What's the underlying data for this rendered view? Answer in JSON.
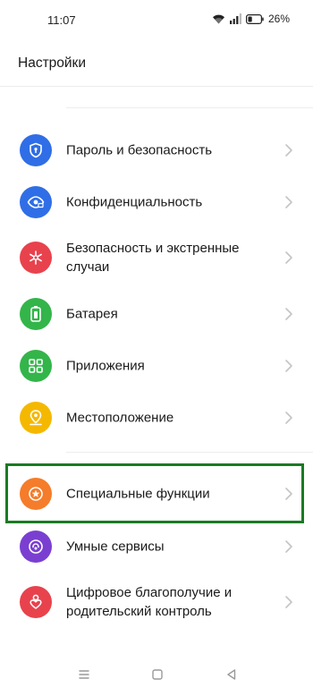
{
  "status_bar": {
    "time": "11:07",
    "battery": "26%"
  },
  "header": {
    "title": "Настройки"
  },
  "items": [
    {
      "label": "Пароль и безопасность",
      "icon": "shield-lock-icon",
      "color": "#2f6ee6"
    },
    {
      "label": "Конфиденциальность",
      "icon": "eye-lock-icon",
      "color": "#2f6ee6"
    },
    {
      "label": "Безопасность и экстренные случаи",
      "icon": "emergency-icon",
      "color": "#e8424d"
    },
    {
      "label": "Батарея",
      "icon": "battery-icon",
      "color": "#33b54a"
    },
    {
      "label": "Приложения",
      "icon": "apps-grid-icon",
      "color": "#33b54a"
    },
    {
      "label": "Местоположение",
      "icon": "location-pin-icon",
      "color": "#f5b800"
    },
    {
      "label": "Специальные функции",
      "icon": "accessibility-star-icon",
      "color": "#f57c2a"
    },
    {
      "label": "Умные сервисы",
      "icon": "smart-services-icon",
      "color": "#7a3fd1"
    },
    {
      "label": "Цифровое благополучие и родительский контроль",
      "icon": "heart-person-icon",
      "color": "#e8424d"
    }
  ],
  "highlight_color": "#1b7a24"
}
